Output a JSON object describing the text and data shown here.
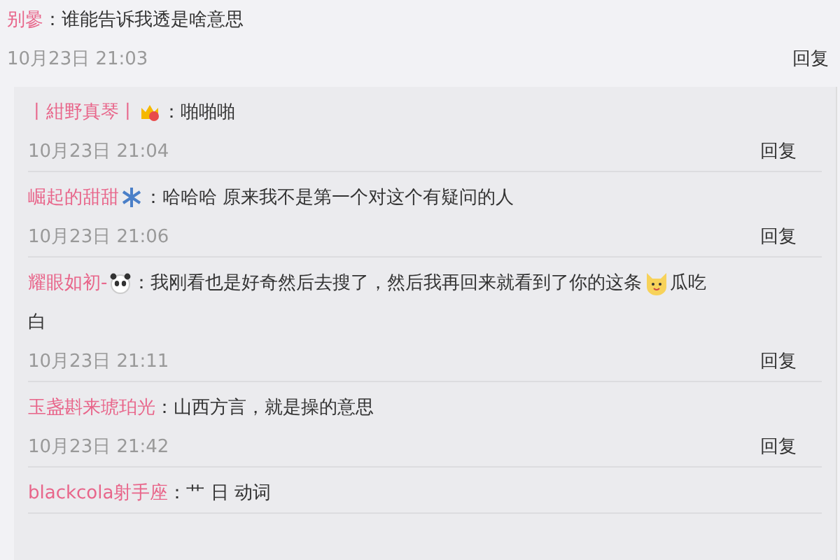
{
  "comment": {
    "user": "别曑",
    "colon": "：",
    "text": "谁能告诉我透是啥意思",
    "time": "10月23日 21:03",
    "reply_label": "回复"
  },
  "replies": [
    {
      "user": "丨紺野真琴丨",
      "badge": {
        "kind": "crown"
      },
      "colon": "：",
      "parts": [
        {
          "kind": "text",
          "text": "啪啪啪"
        }
      ],
      "time": "10月23日 21:04",
      "reply_label": "回复"
    },
    {
      "user": "崛起的甜甜",
      "badge": {
        "kind": "snowflake"
      },
      "colon": "：",
      "parts": [
        {
          "kind": "text",
          "text": "哈哈哈 原来我不是第一个对这个有疑问的人"
        }
      ],
      "time": "10月23日 21:06",
      "reply_label": "回复"
    },
    {
      "user": "耀眼如初-",
      "badge": {
        "kind": "panda"
      },
      "colon": "：",
      "parts": [
        {
          "kind": "text",
          "text": "我刚看也是好奇然后去搜了，然后我再回来就看到了你的这条"
        },
        {
          "kind": "emoji"
        },
        {
          "kind": "text",
          "text": "瓜吃"
        },
        {
          "kind": "break"
        },
        {
          "kind": "text",
          "text": "白"
        }
      ],
      "time": "10月23日 21:11",
      "reply_label": "回复"
    },
    {
      "user": "玉盏斟来琥珀光",
      "colon": "：",
      "parts": [
        {
          "kind": "text",
          "text": "山西方言，就是操的意思"
        }
      ],
      "time": "10月23日 21:42",
      "reply_label": "回复"
    },
    {
      "user": "blackcola射手座",
      "colon": "：",
      "parts": [
        {
          "kind": "text",
          "text": "艹 日 动词"
        }
      ]
    }
  ]
}
